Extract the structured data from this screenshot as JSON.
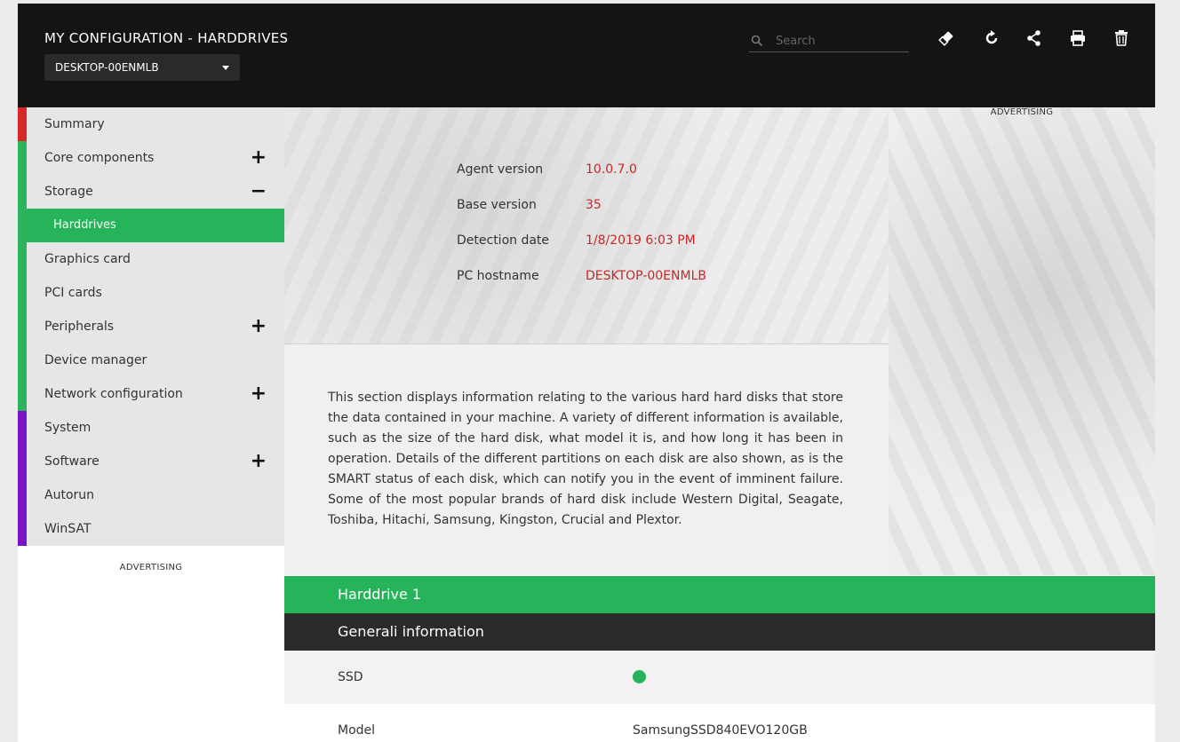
{
  "header": {
    "title": "MY CONFIGURATION - HARDDRIVES",
    "host_selected": "DESKTOP-00ENMLB",
    "search_placeholder": "Search",
    "icons": [
      "eraser-icon",
      "refresh-icon",
      "share-icon",
      "print-icon",
      "trash-icon"
    ]
  },
  "sidebar": {
    "items": [
      {
        "label": "Summary",
        "group": "red"
      },
      {
        "label": "Core components",
        "toggle": "+"
      },
      {
        "label": "Storage",
        "toggle": "−"
      },
      {
        "label": "Harddrives",
        "active": true
      },
      {
        "label": "Graphics card"
      },
      {
        "label": "PCI cards"
      },
      {
        "label": "Peripherals",
        "toggle": "+"
      },
      {
        "label": "Device manager"
      },
      {
        "label": "Network configuration",
        "toggle": "+"
      },
      {
        "label": "System",
        "group": "purple"
      },
      {
        "label": "Software",
        "toggle": "+"
      },
      {
        "label": "Autorun"
      },
      {
        "label": "WinSAT"
      }
    ],
    "advertising": "ADVERTISING"
  },
  "info": {
    "agent_label": "Agent version",
    "agent_value": "10.0.7.0",
    "base_label": "Base version",
    "base_value": "35",
    "date_label": "Detection date",
    "date_value": "1/8/2019 6:03 PM",
    "host_label": "PC hostname",
    "host_value": "DESKTOP-00ENMLB"
  },
  "right_ad": {
    "label": "ADVERTISING"
  },
  "description": "This section displays information relating to the various hard hard disks that store the data contained in your machine. A variety of different information is available, such as the size of the hard disk, what model it is, and how long it has been in operation. Details of the different partitions on each disk are also shown, as is the SMART status of each disk, which can notify you in the event of imminent failure. Some of the most popular brands of hard disk include Western Digital, Seagate, Toshiba, Hitachi, Samsung, Kingston, Crucial and Plextor.",
  "harddrive": {
    "title": "Harddrive 1",
    "section": "Generali information",
    "ssd_label": "SSD",
    "ssd_status": "yes",
    "model_label": "Model",
    "model_value": "SamsungSSD840EVO120GB"
  },
  "colors": {
    "accent_green": "#27b35a",
    "group_red": "#d62828",
    "group_purple": "#7a12c8",
    "value_red": "#c62828"
  }
}
